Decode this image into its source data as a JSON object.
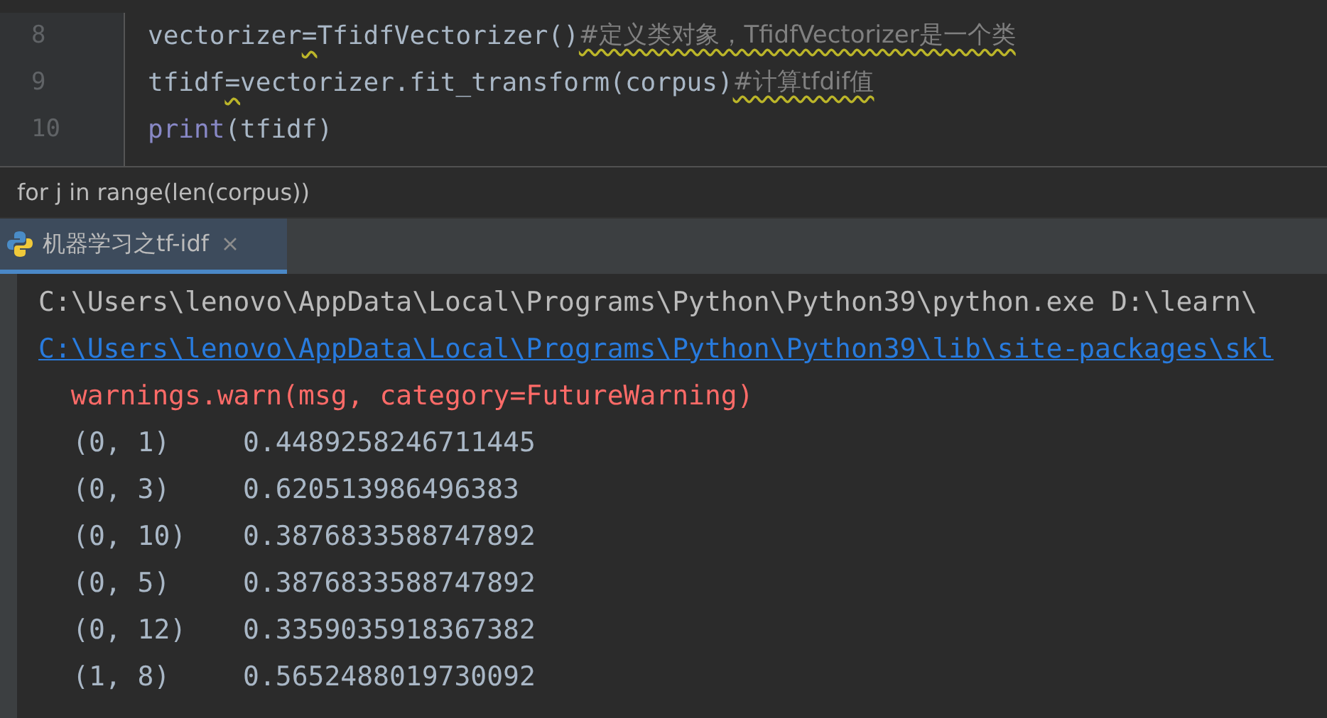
{
  "editor": {
    "lines": [
      {
        "number": "8",
        "tokens": [
          {
            "kind": "code",
            "text": "vectorizer",
            "warn": false
          },
          {
            "kind": "code",
            "text": "=",
            "warn": true
          },
          {
            "kind": "code",
            "text": "TfidfVectorizer()",
            "warn": false
          },
          {
            "kind": "comment",
            "text": "#定义类对象，TfidfVectorizer是一个类",
            "warn": true
          }
        ]
      },
      {
        "number": "9",
        "tokens": [
          {
            "kind": "code",
            "text": "tfidf",
            "warn": false
          },
          {
            "kind": "code",
            "text": "=",
            "warn": true
          },
          {
            "kind": "code",
            "text": "vectorizer.fit_transform(corpus)",
            "warn": false
          },
          {
            "kind": "comment",
            "text": "#计算tfdif值",
            "warn": true
          }
        ]
      },
      {
        "number": "10",
        "tokens": [
          {
            "kind": "builtin",
            "text": "print",
            "warn": false
          },
          {
            "kind": "code",
            "text": "(tfidf)",
            "warn": false
          }
        ]
      }
    ]
  },
  "breadcrumb": "for j in range(len(corpus))",
  "run_tab": {
    "label": "机器学习之tf-idf",
    "selected": true
  },
  "console": {
    "lines": [
      {
        "kind": "plain",
        "text": "C:\\Users\\lenovo\\AppData\\Local\\Programs\\Python\\Python39\\python.exe D:\\learn\\"
      },
      {
        "kind": "link",
        "text": "C:\\Users\\lenovo\\AppData\\Local\\Programs\\Python\\Python39\\lib\\site-packages\\skl"
      },
      {
        "kind": "error",
        "text": "  warnings.warn(msg, category=FutureWarning)"
      },
      {
        "kind": "entry",
        "index": "(0, 1)",
        "value": "0.4489258246711445"
      },
      {
        "kind": "entry",
        "index": "(0, 3)",
        "value": "0.620513986496383"
      },
      {
        "kind": "entry",
        "index": "(0, 10)",
        "value": "0.3876833588747892"
      },
      {
        "kind": "entry",
        "index": "(0, 5)",
        "value": "0.3876833588747892"
      },
      {
        "kind": "entry",
        "index": "(0, 12)",
        "value": "0.3359035918367382"
      },
      {
        "kind": "entry",
        "index": "(1, 8)",
        "value": "0.5652488019730092"
      }
    ]
  }
}
